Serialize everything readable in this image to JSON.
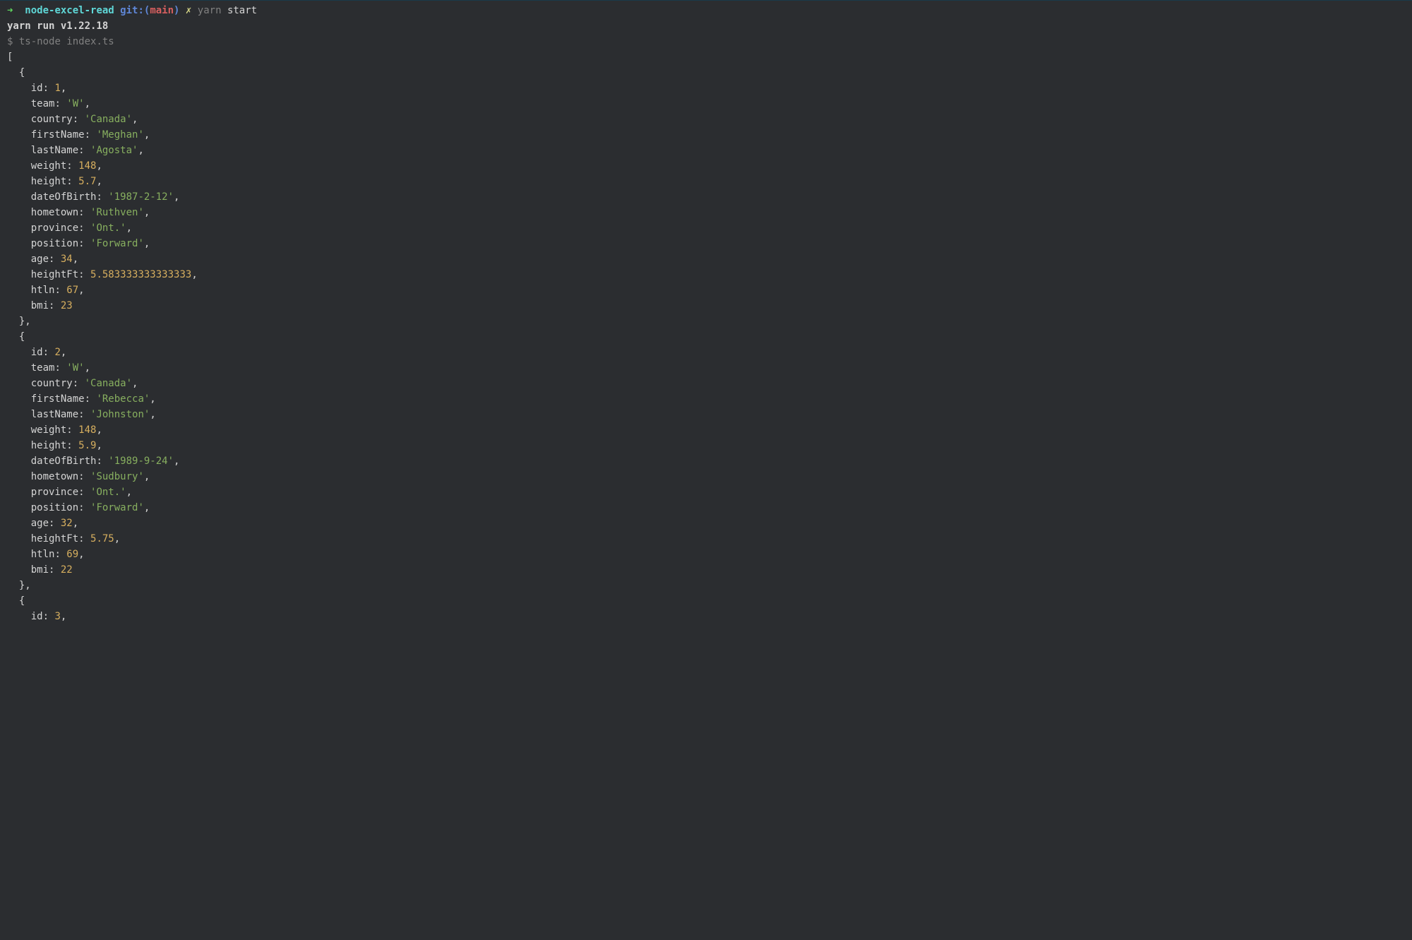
{
  "prompt": {
    "arrow": "➜",
    "dir": "node-excel-read",
    "git_label": "git:(",
    "branch": "main",
    "git_close": ")",
    "dirty": "✗",
    "cmd_exec": "yarn",
    "cmd_arg": "start"
  },
  "lines": {
    "yarn_run": "yarn run v1.22.18",
    "dollar": "$",
    "ts_node": "ts-node index.ts"
  },
  "records": [
    {
      "id": 1,
      "team": "W",
      "country": "Canada",
      "firstName": "Meghan",
      "lastName": "Agosta",
      "weight": 148,
      "height": 5.7,
      "dateOfBirth": "1987-2-12",
      "hometown": "Ruthven",
      "province": "Ont.",
      "position": "Forward",
      "age": 34,
      "heightFt": "5.583333333333333",
      "htln": 67,
      "bmi": 23
    },
    {
      "id": 2,
      "team": "W",
      "country": "Canada",
      "firstName": "Rebecca",
      "lastName": "Johnston",
      "weight": 148,
      "height": 5.9,
      "dateOfBirth": "1989-9-24",
      "hometown": "Sudbury",
      "province": "Ont.",
      "position": "Forward",
      "age": 32,
      "heightFt": "5.75",
      "htln": 69,
      "bmi": 22
    }
  ],
  "partial": {
    "id": 3
  }
}
